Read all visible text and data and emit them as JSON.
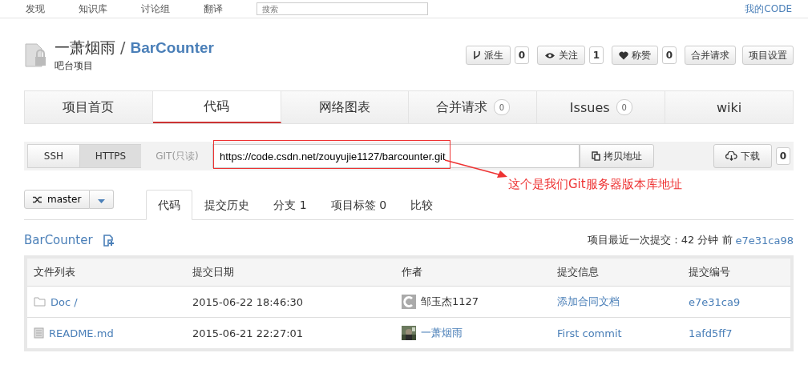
{
  "topnav": {
    "items": [
      "发现",
      "知识库",
      "讨论组",
      "翻译"
    ],
    "search": {
      "placeholder": "搜索"
    },
    "user": "我的CODE"
  },
  "repo": {
    "owner": "一萧烟雨",
    "separator": "/",
    "name": "BarCounter",
    "description": "吧台项目"
  },
  "actions": [
    {
      "kind": "fork",
      "label": "派生",
      "count": "0"
    },
    {
      "kind": "watch",
      "label": "关注",
      "count": "1"
    },
    {
      "kind": "like",
      "label": "称赞",
      "count": "0"
    }
  ],
  "buttons": [
    "合并请求",
    "项目设置"
  ],
  "tabs": [
    {
      "label": "项目首页",
      "selected": false
    },
    {
      "label": "代码",
      "selected": true
    },
    {
      "label": "网络图表",
      "selected": false
    },
    {
      "label": "合并请求",
      "count": "0",
      "selected": false
    },
    {
      "label": "Issues",
      "count": "0",
      "selected": false
    },
    {
      "label": "wiki",
      "selected": false
    }
  ],
  "clone": {
    "protocols": [
      {
        "label": "SSH",
        "selected": false,
        "disabled": false
      },
      {
        "label": "HTTPS",
        "selected": true,
        "disabled": false
      },
      {
        "label": "GIT(只读)",
        "selected": false,
        "disabled": true
      }
    ],
    "url": "https://code.csdn.net/zouyujie1127/barcounter.git",
    "copy": "拷贝地址",
    "download": "下载",
    "download_count": "0"
  },
  "annotation": "这个是我们Git服务器版本库地址",
  "branch": "master",
  "subtabs": [
    {
      "label": "代码",
      "selected": true
    },
    {
      "label": "提交历史",
      "selected": false
    },
    {
      "label": "分支 1",
      "selected": false
    },
    {
      "label": "项目标签 0",
      "selected": false
    },
    {
      "label": "比较",
      "selected": false
    }
  ],
  "path": "BarCounter",
  "last_commit": {
    "label": "项目最近一次提交：42 分钟 前",
    "hash": "e7e31ca98"
  },
  "table": {
    "columns": [
      "文件列表",
      "提交日期",
      "作者",
      "提交信息",
      "提交编号"
    ],
    "rows": [
      {
        "kind": "folder",
        "name": "Doc /",
        "date": "2015-06-22 18:46:30",
        "author": "邹玉杰1127",
        "avatar": {
          "kind": "logo"
        },
        "message": "添加合同文档",
        "hash": "e7e31ca9"
      },
      {
        "kind": "file",
        "name": "README.md",
        "date": "2015-06-21 22:27:01",
        "author": "一萧烟雨",
        "message": "First commit",
        "hash": "1afd5ff7"
      }
    ]
  }
}
